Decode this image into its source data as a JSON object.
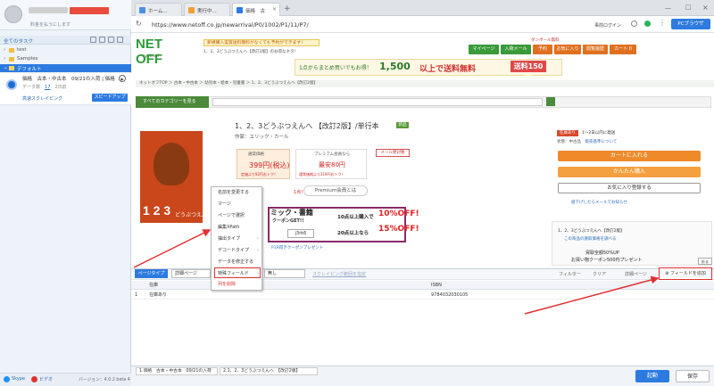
{
  "app": {
    "login_hint": "料金を払うにします",
    "all_tasks": "全てのタスク",
    "tree": [
      "test",
      "Samples"
    ],
    "default_folder": "デフォルト",
    "task": {
      "title": "価格　古本・中古本　09/21の入荷 | 価格",
      "data_label": "データ数：",
      "data_count": "17",
      "last_run": "2日前",
      "type": "高速スクレイピング",
      "speedup": "スピードアップ"
    },
    "footer": {
      "skype": "Skype",
      "line": "ビデオ",
      "version": "バージョン：4.0.2 beta 4"
    }
  },
  "browser": {
    "tabs": [
      {
        "label": "ホーム..."
      },
      {
        "label": "実行中..."
      },
      {
        "label": "価格　古"
      }
    ],
    "new_tab": "+",
    "url": "https://www.netoff.co.jp/newarrival/P0/1002/P1/11/P7/",
    "pc_browser": "PCブラウザ",
    "login_link": "事前ログイン"
  },
  "site": {
    "logo": "NET OFF",
    "logo_sub": "by Netoff",
    "banner1": "新規購入実質送料無料がなくても予約ができます！",
    "banner2": "1、2、3どうぶつえんへ【改訂2版】のお得なネタ!",
    "header_buttons": [
      "ダンボール無料",
      "マイページ",
      "入荷メール",
      "予約",
      "お気に入り",
      "閲覧履歴",
      "カート 0"
    ],
    "promo_a": "1点からまとめ買いでもお得！",
    "promo_b": "1,500",
    "promo_c": "以上で送料無料",
    "promo_d": "送料150円",
    "breadcrumbs": "ネットオフTOP ＞ 古本・中古本 ＞ 幼児本・絵本・児童書 ＞ 1、2、3どうぶつえんへ【改訂2版】",
    "category_btn": "すべてのカテゴリーを見る",
    "book": {
      "title": "1、2、3どうぶつえんへ 【改訂2版】/単行本",
      "badge": "新品",
      "author": "作家：エリック・カール",
      "price_label": "通常価格",
      "price": "399円(税込)",
      "price_note": "定価より92円おトク！",
      "premium_label": "プレミアム会員なら",
      "premium_price": "最安80円",
      "premium_note": "通常価格より319円おトク！",
      "mail_notify": "メール便対象",
      "points": "1点！",
      "premium_link": "Premium会員とは",
      "cover_text": "1 2 3",
      "cover_sub": "どうぶつえんへ"
    },
    "coupon": {
      "title": "ミック・書籍",
      "subtitle": "クーポンGET!!",
      "line1": "10点以上購入で",
      "line1_off": "10%OFF!",
      "line2": "20点以上なら",
      "line2_off": "15%OFF!",
      "code": "j3rk6",
      "link": "P1R得きクーポンプレゼント"
    },
    "side": {
      "stock": "在庫あり",
      "ship": "1〜2日以内に発送",
      "condition": "状態：中古品",
      "condition_link": "販売基準について",
      "cart_btn": "カートに入れる",
      "easy_btn": "かんたん購入",
      "fav_btn": "お気に入り登録する",
      "low_price": "値下げしたらメールでお知らせ",
      "related": "1、2、3どうぶつえんへ【改訂2版】",
      "related2": "この商品の買取価格を調べる",
      "buy_all": "買取全額50%UP",
      "buy_all2": "お買い物クーポン500円プレゼント",
      "fold": "折る"
    }
  },
  "context_menu": {
    "items": [
      {
        "label": "名前を変更する",
        "chev": false
      },
      {
        "label": "マージ",
        "chev": false
      },
      {
        "label": "ページで選択",
        "chev": false
      },
      {
        "label": "編集XPath",
        "chev": false
      },
      {
        "label": "抽出タイプ",
        "chev": true
      },
      {
        "label": "デコードタイプ",
        "chev": true
      },
      {
        "label": "データを修正する",
        "chev": false
      },
      {
        "label": "特殊フィールド",
        "chev": true
      },
      {
        "label": "列を削除",
        "chev": false
      }
    ]
  },
  "bottom_panel": {
    "page_type": "ページタイプ",
    "detail_page": "詳細ページ",
    "no_scroll": "無し",
    "scroll_range": "スクレイピング範囲を指定",
    "filter": "フィルター",
    "clear": "クリア",
    "detail_switch": "詳細ページ",
    "add_field": "フィールドを追加",
    "columns": [
      "",
      "在庫",
      "ISBN"
    ],
    "rows": [
      {
        "index": "1",
        "stock": "在庫あり",
        "isbn": "9784032030105"
      }
    ],
    "tabs": [
      "1.価格　古本・中古本　09/21の入荷",
      "2.1、2、3どうぶつえんへ　【改訂2版】"
    ],
    "start": "起動",
    "save": "保存"
  }
}
